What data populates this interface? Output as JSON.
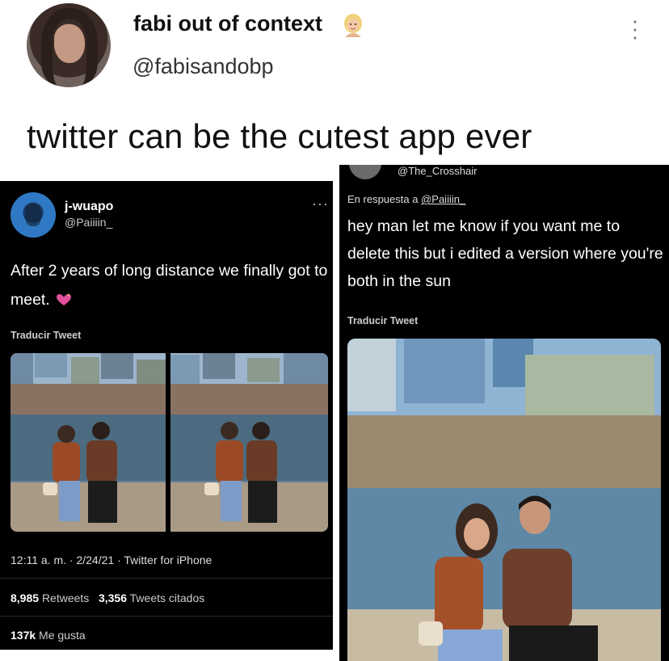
{
  "post": {
    "display_name": "fabi out of context",
    "handle": "@fabisandobp",
    "text": "twitter can be the cutest app ever",
    "name_emoji": "blonde-person-emoji"
  },
  "left_tweet": {
    "display_name": "j-wuapo",
    "handle": "@Paiiiin_",
    "text": "After 2 years of long distance we finally got to meet.",
    "translate_label": "Traducir Tweet",
    "time": "12:11 a. m.",
    "date": "2/24/21",
    "source": "Twitter for iPhone",
    "retweets_count": "8,985",
    "retweets_label": "Retweets",
    "quotes_count": "3,356",
    "quotes_label": "Tweets citados",
    "likes_count": "137k",
    "likes_label": "Me gusta"
  },
  "right_tweet": {
    "handle": "@The_Crosshair",
    "reply_prefix": "En respuesta a",
    "reply_to": "@Paiiiin_",
    "text": "hey man let me know if you want me to delete this but i edited a version where you're both in the sun",
    "translate_label": "Traducir Tweet"
  },
  "colors": {
    "page_background": "#ffffff",
    "embedded_background": "#000000",
    "heart_emoji": "#e0509b"
  }
}
